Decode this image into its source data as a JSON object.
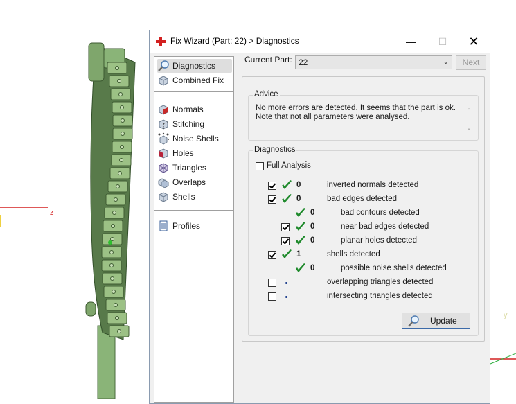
{
  "dialog": {
    "title": "Fix Wizard (Part: 22) > Diagnostics",
    "window_controls": {
      "minimize": "—",
      "maximize": "☐",
      "close": "✕"
    }
  },
  "nav": {
    "group1": [
      {
        "label": "Diagnostics",
        "icon": "magnifier-icon",
        "selected": true
      },
      {
        "label": "Combined Fix",
        "icon": "cube-icon"
      }
    ],
    "group2": [
      {
        "label": "Normals",
        "icon": "normals-cube-icon"
      },
      {
        "label": "Stitching",
        "icon": "stitching-cube-icon"
      },
      {
        "label": "Noise Shells",
        "icon": "noise-shells-icon"
      },
      {
        "label": "Holes",
        "icon": "holes-cube-icon"
      },
      {
        "label": "Triangles",
        "icon": "triangles-icon"
      },
      {
        "label": "Overlaps",
        "icon": "overlaps-cube-icon"
      },
      {
        "label": "Shells",
        "icon": "shells-cube-icon"
      }
    ],
    "group3": [
      {
        "label": "Profiles",
        "icon": "document-icon"
      }
    ]
  },
  "part": {
    "label": "Current Part:",
    "value": "22",
    "next_label": "Next"
  },
  "advice": {
    "title": "Advice",
    "line1": "No more errors are detected. It seems that the part is ok.",
    "line2": "Note that not all parameters were analysed."
  },
  "diagnostics": {
    "title": "Diagnostics",
    "full_analysis_label": "Full Analysis",
    "full_analysis_checked": false,
    "rows": [
      {
        "checkbox": true,
        "checked": true,
        "status": "ok",
        "count": "0",
        "label": "inverted normals detected",
        "indent": 0
      },
      {
        "checkbox": true,
        "checked": true,
        "status": "ok",
        "count": "0",
        "label": "bad edges detected",
        "indent": 0
      },
      {
        "checkbox": false,
        "checked": false,
        "status": "ok",
        "count": "0",
        "label": "bad contours detected",
        "indent": 1
      },
      {
        "checkbox": true,
        "checked": true,
        "status": "ok",
        "count": "0",
        "label": "near bad edges detected",
        "indent": 1
      },
      {
        "checkbox": true,
        "checked": true,
        "status": "ok",
        "count": "0",
        "label": "planar holes detected",
        "indent": 1
      },
      {
        "checkbox": true,
        "checked": true,
        "status": "ok",
        "count": "1",
        "label": "shells detected",
        "indent": 0
      },
      {
        "checkbox": false,
        "checked": false,
        "status": "ok",
        "count": "0",
        "label": "possible noise shells detected",
        "indent": 1
      },
      {
        "checkbox": true,
        "checked": false,
        "status": "dot",
        "count": "",
        "label": "overlapping triangles detected",
        "indent": 0
      },
      {
        "checkbox": true,
        "checked": false,
        "status": "dot",
        "count": "",
        "label": "intersecting triangles detected",
        "indent": 0
      }
    ],
    "update_label": "Update"
  },
  "viewport": {
    "axis_label": "z",
    "axis_label_y": "y"
  },
  "colors": {
    "accent": "#1a7f1a",
    "tick": "#1f8a2c",
    "model": "#7da66a",
    "axis_red": "#d42020",
    "axis_green": "#2fb040"
  }
}
